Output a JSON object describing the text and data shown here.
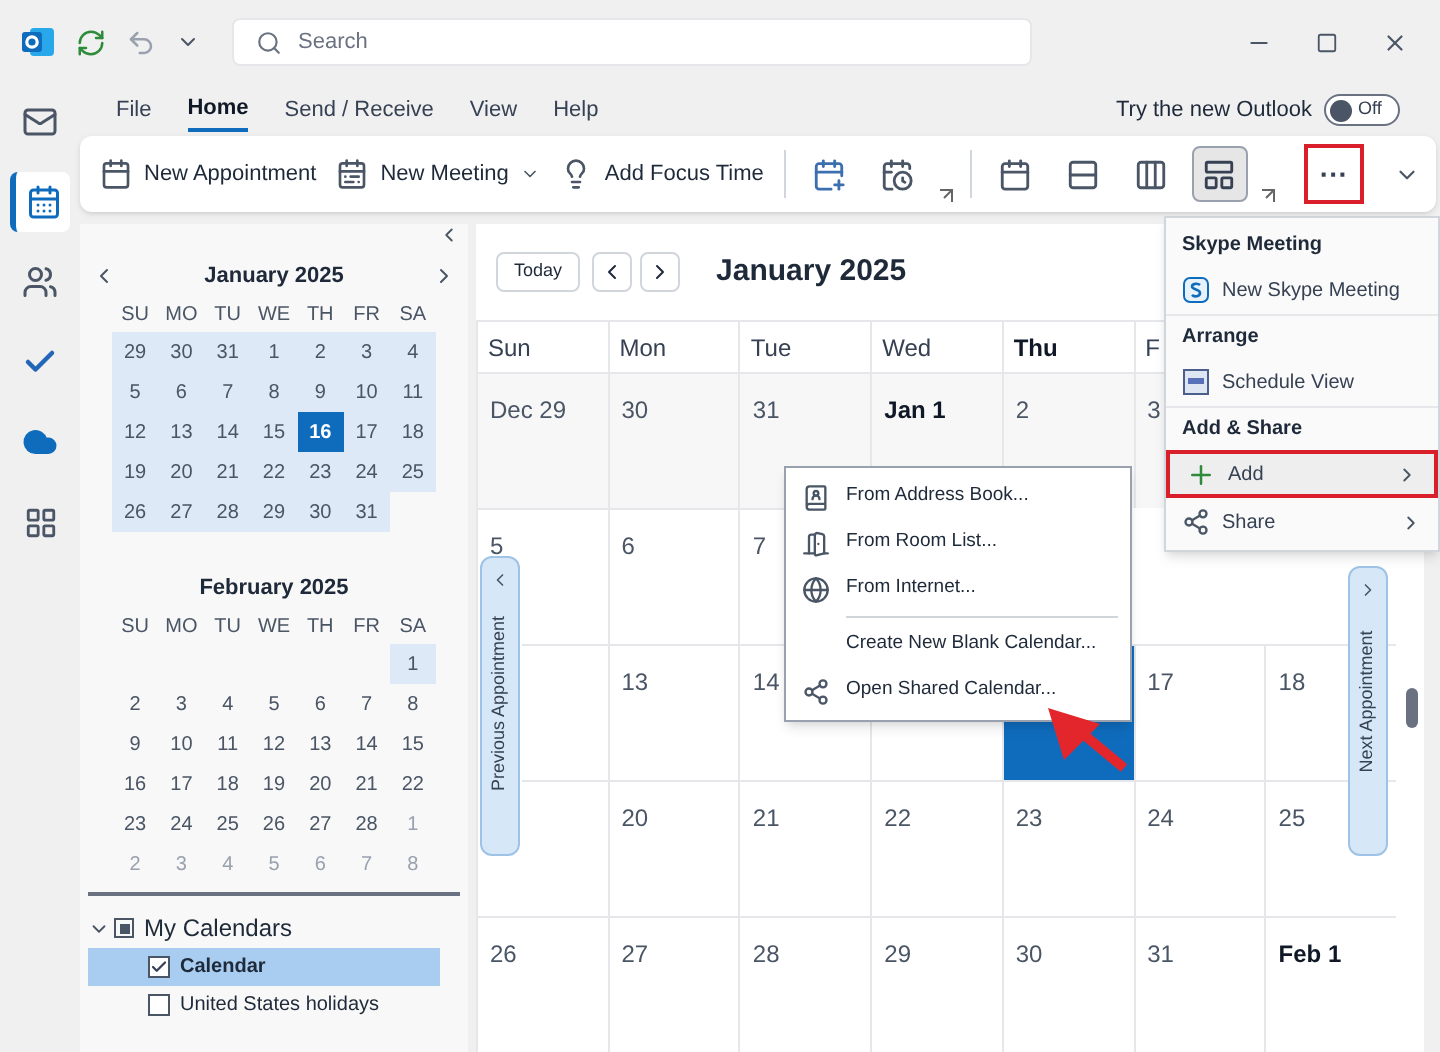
{
  "title_bar": {
    "search": {
      "placeholder": "Search"
    }
  },
  "nav_rail": [
    {
      "kind": "mail",
      "selected": false
    },
    {
      "kind": "calendar",
      "selected": true
    },
    {
      "kind": "people",
      "selected": false
    },
    {
      "kind": "todo",
      "selected": false
    },
    {
      "kind": "cloud",
      "selected": false
    },
    {
      "kind": "apps",
      "selected": false
    }
  ],
  "menu_tabs": [
    {
      "label": "File",
      "selected": false
    },
    {
      "label": "Home",
      "selected": true
    },
    {
      "label": "Send / Receive",
      "selected": false
    },
    {
      "label": "View",
      "selected": false
    },
    {
      "label": "Help",
      "selected": false
    }
  ],
  "new_outlook": {
    "label": "Try the new Outlook",
    "toggle": {
      "label": "Off",
      "on": false
    }
  },
  "ribbon": [
    {
      "kind": "labeled",
      "label": "New Appointment",
      "dropdown": false
    },
    {
      "kind": "labeled",
      "label": "New Meeting",
      "dropdown": true
    },
    {
      "kind": "labeled",
      "label": "Add Focus Time",
      "dropdown": false
    },
    {
      "kind": "separator"
    },
    {
      "kind": "icon",
      "selected": false
    },
    {
      "kind": "icon",
      "selected": false
    },
    {
      "kind": "launcher"
    },
    {
      "kind": "separator"
    },
    {
      "kind": "icon",
      "selected": false
    },
    {
      "kind": "icon",
      "selected": false
    },
    {
      "kind": "icon",
      "selected": false
    },
    {
      "kind": "icon",
      "selected": true
    },
    {
      "kind": "launcher"
    },
    {
      "kind": "more",
      "label": "···",
      "highlighted": true
    }
  ],
  "mini_calendars": [
    {
      "title": "January 2025",
      "weekdays": [
        "SU",
        "MO",
        "TU",
        "WE",
        "TH",
        "FR",
        "SA"
      ],
      "weeks": [
        [
          {
            "label": "29",
            "muted": false,
            "in_range": true,
            "selected": false
          },
          {
            "label": "30",
            "muted": false,
            "in_range": true,
            "selected": false
          },
          {
            "label": "31",
            "muted": false,
            "in_range": true,
            "selected": false
          },
          {
            "label": "1",
            "muted": false,
            "in_range": true,
            "selected": false
          },
          {
            "label": "2",
            "muted": false,
            "in_range": true,
            "selected": false
          },
          {
            "label": "3",
            "muted": false,
            "in_range": true,
            "selected": false
          },
          {
            "label": "4",
            "muted": false,
            "in_range": true,
            "selected": false
          }
        ],
        [
          {
            "label": "5",
            "muted": false,
            "in_range": true,
            "selected": false
          },
          {
            "label": "6",
            "muted": false,
            "in_range": true,
            "selected": false
          },
          {
            "label": "7",
            "muted": false,
            "in_range": true,
            "selected": false
          },
          {
            "label": "8",
            "muted": false,
            "in_range": true,
            "selected": false
          },
          {
            "label": "9",
            "muted": false,
            "in_range": true,
            "selected": false
          },
          {
            "label": "10",
            "muted": false,
            "in_range": true,
            "selected": false
          },
          {
            "label": "11",
            "muted": false,
            "in_range": true,
            "selected": false
          }
        ],
        [
          {
            "label": "12",
            "muted": false,
            "in_range": true,
            "selected": false
          },
          {
            "label": "13",
            "muted": false,
            "in_range": true,
            "selected": false
          },
          {
            "label": "14",
            "muted": false,
            "in_range": true,
            "selected": false
          },
          {
            "label": "15",
            "muted": false,
            "in_range": true,
            "selected": false
          },
          {
            "label": "16",
            "muted": false,
            "in_range": true,
            "selected": true
          },
          {
            "label": "17",
            "muted": false,
            "in_range": true,
            "selected": false
          },
          {
            "label": "18",
            "muted": false,
            "in_range": true,
            "selected": false
          }
        ],
        [
          {
            "label": "19",
            "muted": false,
            "in_range": true,
            "selected": false
          },
          {
            "label": "20",
            "muted": false,
            "in_range": true,
            "selected": false
          },
          {
            "label": "21",
            "muted": false,
            "in_range": true,
            "selected": false
          },
          {
            "label": "22",
            "muted": false,
            "in_range": true,
            "selected": false
          },
          {
            "label": "23",
            "muted": false,
            "in_range": true,
            "selected": false
          },
          {
            "label": "24",
            "muted": false,
            "in_range": true,
            "selected": false
          },
          {
            "label": "25",
            "muted": false,
            "in_range": true,
            "selected": false
          }
        ],
        [
          {
            "label": "26",
            "muted": false,
            "in_range": true,
            "selected": false
          },
          {
            "label": "27",
            "muted": false,
            "in_range": true,
            "selected": false
          },
          {
            "label": "28",
            "muted": false,
            "in_range": true,
            "selected": false
          },
          {
            "label": "29",
            "muted": false,
            "in_range": true,
            "selected": false
          },
          {
            "label": "30",
            "muted": false,
            "in_range": true,
            "selected": false
          },
          {
            "label": "31",
            "muted": false,
            "in_range": true,
            "selected": false
          }
        ]
      ]
    },
    {
      "title": "February 2025",
      "weekdays": [
        "SU",
        "MO",
        "TU",
        "WE",
        "TH",
        "FR",
        "SA"
      ],
      "weeks": [
        [
          {
            "label": "1",
            "muted": false,
            "in_range": true,
            "selected": false
          }
        ],
        [
          {
            "label": "2",
            "muted": false,
            "in_range": false,
            "selected": false
          },
          {
            "label": "3",
            "muted": false,
            "in_range": false,
            "selected": false
          },
          {
            "label": "4",
            "muted": false,
            "in_range": false,
            "selected": false
          },
          {
            "label": "5",
            "muted": false,
            "in_range": false,
            "selected": false
          },
          {
            "label": "6",
            "muted": false,
            "in_range": false,
            "selected": false
          },
          {
            "label": "7",
            "muted": false,
            "in_range": false,
            "selected": false
          },
          {
            "label": "8",
            "muted": false,
            "in_range": false,
            "selected": false
          }
        ],
        [
          {
            "label": "9",
            "muted": false,
            "in_range": false,
            "selected": false
          },
          {
            "label": "10",
            "muted": false,
            "in_range": false,
            "selected": false
          },
          {
            "label": "11",
            "muted": false,
            "in_range": false,
            "selected": false
          },
          {
            "label": "12",
            "muted": false,
            "in_range": false,
            "selected": false
          },
          {
            "label": "13",
            "muted": false,
            "in_range": false,
            "selected": false
          },
          {
            "label": "14",
            "muted": false,
            "in_range": false,
            "selected": false
          },
          {
            "label": "15",
            "muted": false,
            "in_range": false,
            "selected": false
          }
        ],
        [
          {
            "label": "16",
            "muted": false,
            "in_range": false,
            "selected": false
          },
          {
            "label": "17",
            "muted": false,
            "in_range": false,
            "selected": false
          },
          {
            "label": "18",
            "muted": false,
            "in_range": false,
            "selected": false
          },
          {
            "label": "19",
            "muted": false,
            "in_range": false,
            "selected": false
          },
          {
            "label": "20",
            "muted": false,
            "in_range": false,
            "selected": false
          },
          {
            "label": "21",
            "muted": false,
            "in_range": false,
            "selected": false
          },
          {
            "label": "22",
            "muted": false,
            "in_range": false,
            "selected": false
          }
        ],
        [
          {
            "label": "23",
            "muted": false,
            "in_range": false,
            "selected": false
          },
          {
            "label": "24",
            "muted": false,
            "in_range": false,
            "selected": false
          },
          {
            "label": "25",
            "muted": false,
            "in_range": false,
            "selected": false
          },
          {
            "label": "26",
            "muted": false,
            "in_range": false,
            "selected": false
          },
          {
            "label": "27",
            "muted": false,
            "in_range": false,
            "selected": false
          },
          {
            "label": "28",
            "muted": false,
            "in_range": false,
            "selected": false
          },
          {
            "label": "1",
            "muted": true,
            "in_range": false,
            "selected": false
          }
        ],
        [
          {
            "label": "2",
            "muted": true,
            "in_range": false,
            "selected": false
          },
          {
            "label": "3",
            "muted": true,
            "in_range": false,
            "selected": false
          },
          {
            "label": "4",
            "muted": true,
            "in_range": false,
            "selected": false
          },
          {
            "label": "5",
            "muted": true,
            "in_range": false,
            "selected": false
          },
          {
            "label": "6",
            "muted": true,
            "in_range": false,
            "selected": false
          },
          {
            "label": "7",
            "muted": true,
            "in_range": false,
            "selected": false
          },
          {
            "label": "8",
            "muted": true,
            "in_range": false,
            "selected": false
          }
        ]
      ]
    }
  ],
  "folders": {
    "group": {
      "label": "My Calendars",
      "expanded": true,
      "checked": true
    },
    "items": [
      {
        "label": "Calendar",
        "checked": true,
        "selected": true
      },
      {
        "label": "United States holidays",
        "checked": false,
        "selected": false
      }
    ]
  },
  "calendar": {
    "today_button": "Today",
    "title": "January 2025",
    "weekdays": [
      {
        "label": "Sun",
        "bold": false
      },
      {
        "label": "Mon",
        "bold": false
      },
      {
        "label": "Tue",
        "bold": false
      },
      {
        "label": "Wed",
        "bold": false
      },
      {
        "label": "Thu",
        "bold": true
      },
      {
        "label": "F",
        "bold": false
      }
    ],
    "weeks": [
      [
        {
          "label": "Dec 29",
          "bold": false,
          "selected": false
        },
        {
          "label": "30",
          "bold": false,
          "selected": false
        },
        {
          "label": "31",
          "bold": false,
          "selected": false
        },
        {
          "label": "Jan 1",
          "bold": true,
          "selected": false
        },
        {
          "label": "2",
          "bold": false,
          "selected": false
        },
        {
          "label": "3",
          "bold": false,
          "selected": false
        }
      ],
      [
        {
          "label": "5",
          "bold": false,
          "selected": false
        },
        {
          "label": "6",
          "bold": false,
          "selected": false
        },
        {
          "label": "7",
          "bold": false,
          "selected": false
        }
      ],
      [
        {
          "selected": false
        },
        {
          "label": "13",
          "bold": false,
          "selected": false
        },
        {
          "label": "14",
          "bold": false,
          "selected": false
        },
        {
          "selected": false
        },
        {
          "selected": true
        },
        {
          "label": "17",
          "bold": false,
          "selected": false
        },
        {
          "label": "18",
          "bold": false,
          "selected": false
        }
      ],
      [
        {
          "selected": false
        },
        {
          "label": "20",
          "bold": false,
          "selected": false
        },
        {
          "label": "21",
          "bold": false,
          "selected": false
        },
        {
          "label": "22",
          "bold": false,
          "selected": false
        },
        {
          "label": "23",
          "bold": false,
          "selected": false
        },
        {
          "label": "24",
          "bold": false,
          "selected": false
        },
        {
          "label": "25",
          "bold": false,
          "selected": false
        }
      ],
      [
        {
          "label": "26",
          "bold": false,
          "selected": false
        },
        {
          "label": "27",
          "bold": false,
          "selected": false
        },
        {
          "label": "28",
          "bold": false,
          "selected": false
        },
        {
          "label": "29",
          "bold": false,
          "selected": false
        },
        {
          "label": "30",
          "bold": false,
          "selected": false
        },
        {
          "label": "31",
          "bold": false,
          "selected": false
        },
        {
          "label": "Feb 1",
          "bold": true,
          "selected": false
        }
      ]
    ],
    "previous_tab": "Previous Appointment",
    "next_tab": "Next Appointment"
  },
  "more_menu": [
    {
      "kind": "heading",
      "label": "Skype Meeting"
    },
    {
      "kind": "item",
      "label": "New Skype Meeting",
      "submenu": false,
      "highlighted": false
    },
    {
      "kind": "heading",
      "label": "Arrange"
    },
    {
      "kind": "item",
      "label": "Schedule View",
      "submenu": false,
      "highlighted": false
    },
    {
      "kind": "heading",
      "label": "Add & Share"
    },
    {
      "kind": "item",
      "label": "Add",
      "submenu": true,
      "highlighted": true
    },
    {
      "kind": "item",
      "label": "Share",
      "submenu": true,
      "highlighted": false
    }
  ],
  "add_menu": [
    {
      "kind": "item",
      "label": "From Address Book..."
    },
    {
      "kind": "item",
      "label": "From Room List..."
    },
    {
      "kind": "item",
      "label": "From Internet..."
    },
    {
      "kind": "separator"
    },
    {
      "kind": "item",
      "label": "Create New Blank Calendar..."
    },
    {
      "kind": "item",
      "label": "Open Shared Calendar..."
    }
  ]
}
